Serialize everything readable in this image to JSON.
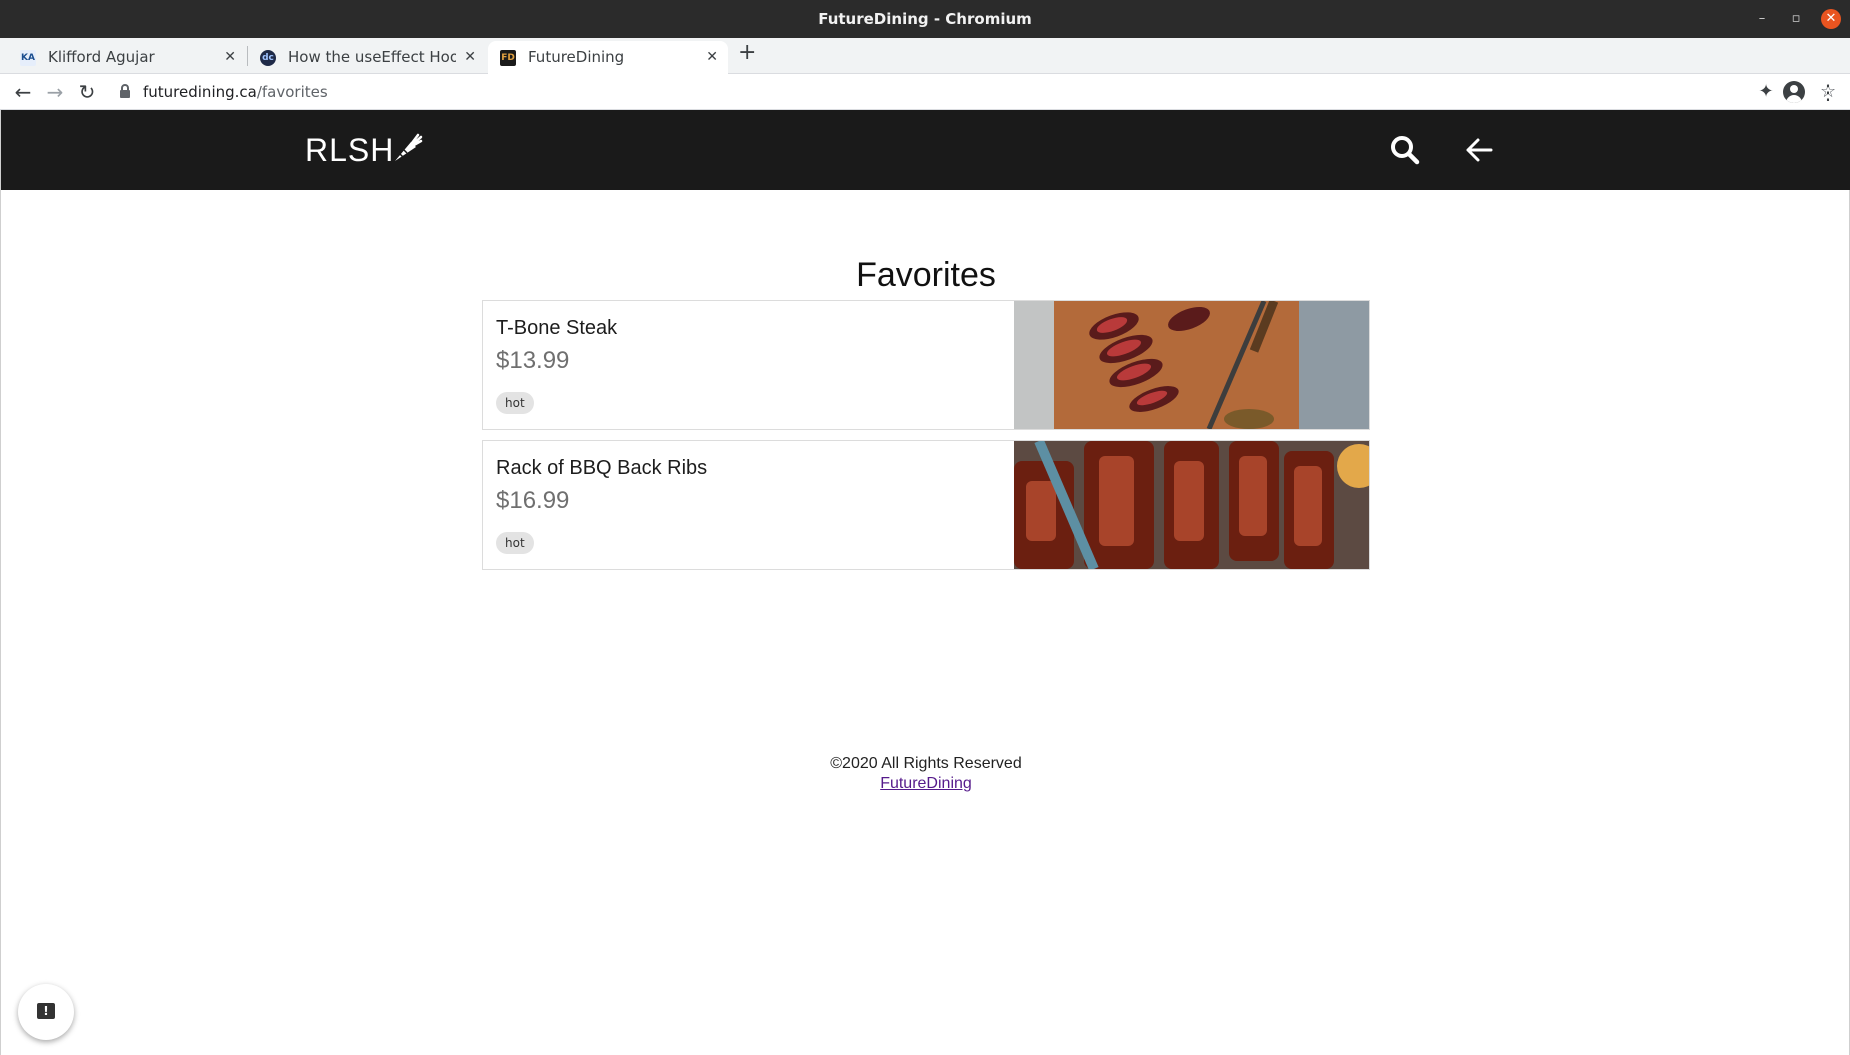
{
  "window": {
    "title": "FutureDining - Chromium"
  },
  "tabs": [
    {
      "favicon": "KA",
      "label": "Klifford Agujar"
    },
    {
      "favicon": "dc",
      "label": "How the useEffect Hook W"
    },
    {
      "favicon": "FD",
      "label": "FutureDining"
    }
  ],
  "address_bar": {
    "host": "futuredining.ca",
    "path": "/favorites"
  },
  "app": {
    "logo_text": "RLSH",
    "page_title": "Favorites",
    "items": [
      {
        "name": "T-Bone Steak",
        "price": "$13.99",
        "tag": "hot"
      },
      {
        "name": "Rack of BBQ Back Ribs",
        "price": "$16.99",
        "tag": "hot"
      }
    ],
    "footer": {
      "copyright": "©2020 All Rights Reserved",
      "link": "FutureDining"
    }
  },
  "colors": {
    "header_bg": "#1a1a1a",
    "tag_bg": "#e3e3e3",
    "price_text": "#6f6f6f",
    "link": "#551a8b"
  }
}
